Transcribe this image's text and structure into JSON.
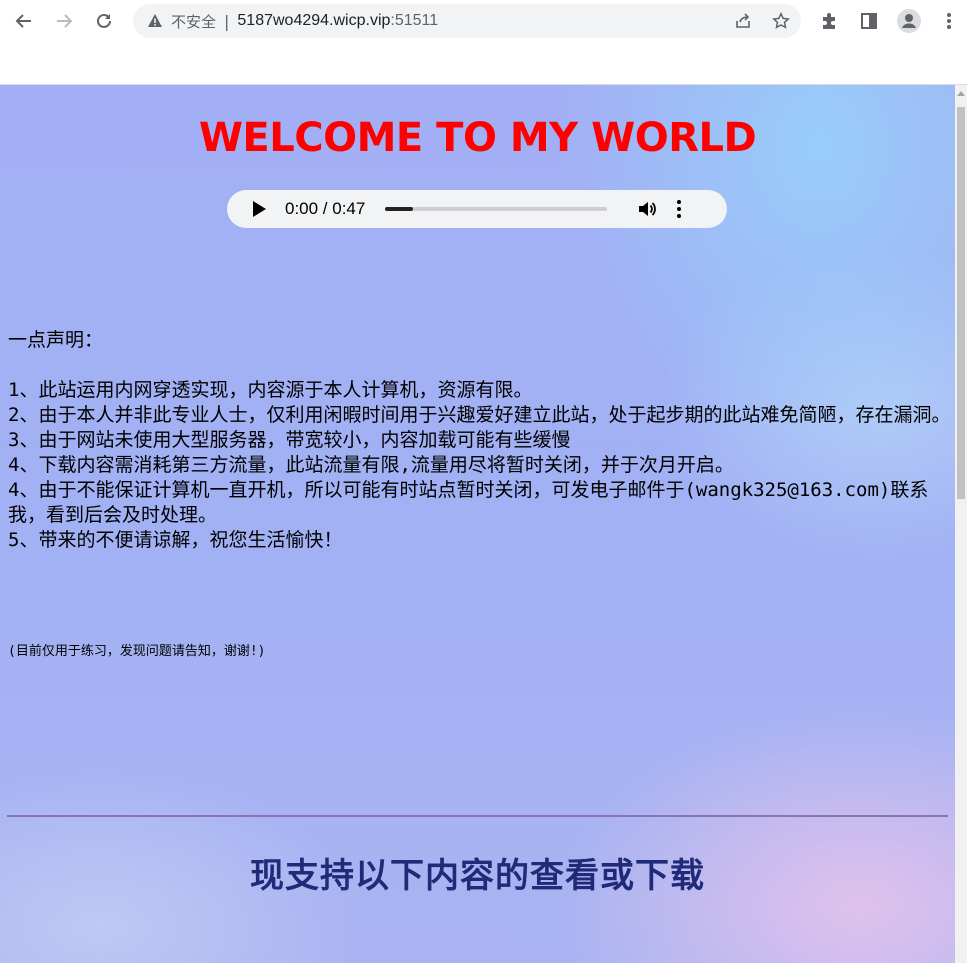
{
  "browser": {
    "security_label": "不安全",
    "separator": "|",
    "url_host": "5187wo4294.wicp.vip",
    "url_port": ":51511",
    "icons": [
      "back-arrow-icon",
      "forward-arrow-icon",
      "reload-icon",
      "warning-icon",
      "share-icon",
      "star-icon",
      "extensions-icon",
      "side-panel-icon",
      "profile-icon",
      "menu-dots-icon"
    ]
  },
  "page": {
    "title": "WELCOME TO MY WORLD",
    "audio": {
      "time": "0:00 / 0:47",
      "progress": 0.126
    },
    "notice": {
      "heading": "一点声明：",
      "items": [
        "1、此站运用内网穿透实现，内容源于本人计算机，资源有限。",
        "2、由于本人并非此专业人士，仅利用闲暇时间用于兴趣爱好建立此站，处于起步期的此站难免简陋，存在漏洞。",
        "3、由于网站未使用大型服务器，带宽较小，内容加载可能有些缓慢",
        "4、下载内容需消耗第三方流量，此站流量有限,流量用尽将暂时关闭，并于次月开启。",
        "4、由于不能保证计算机一直开机，所以可能有时站点暂时关闭，可发电子邮件于(wangk325@163.com)联系我，看到后会及时处理。",
        "5、带来的不便请谅解，祝您生活愉快！"
      ]
    },
    "small_note": "(目前仅用于练习，发现问题请告知，谢谢!)",
    "section_heading": "现支持以下内容的查看或下载"
  }
}
